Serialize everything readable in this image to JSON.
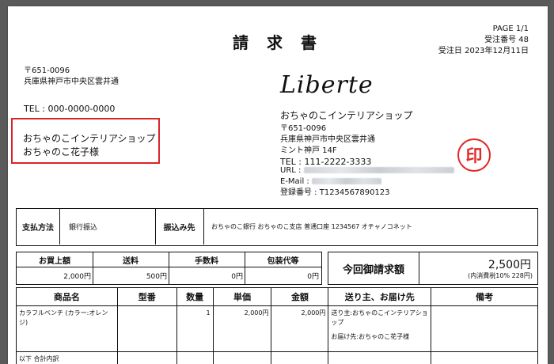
{
  "document": {
    "title": "請 求 書",
    "page": "PAGE 1/1",
    "order_no": "受注番号  48",
    "order_date": "受注日 2023年12月11日"
  },
  "recipient": {
    "postal": "〒651-0096",
    "address": "兵庫県神戸市中央区雲井通",
    "tel": "TEL : 000-0000-0000",
    "company": "おちゃのこインテリアショップ",
    "name": "おちゃのこ花子様"
  },
  "issuer": {
    "logo": "Liberte",
    "shop_name": "おちゃのこインテリアショップ",
    "postal": "〒651-0096",
    "address": "兵庫県神戸市中央区雲井通",
    "building": "ミント神戸 14F",
    "tel": "TEL : 111-2222-3333",
    "url_label": "URL :",
    "email_label": "E-Mail :",
    "registration": "登録番号 : T1234567890123",
    "stamp": "印"
  },
  "payment": {
    "method_label": "支払方法",
    "method_value": "銀行振込",
    "dest_label": "振込み先",
    "dest_value": "おちゃのこ銀行 おちゃのこ支店 普通口座 1234567 オチャノコネット"
  },
  "summary": {
    "headers": [
      "お買上額",
      "送料",
      "手数料",
      "包装代等"
    ],
    "values": [
      "2,000円",
      "500円",
      "0円",
      "0円"
    ],
    "total_label": "今回御請求額",
    "total_value": "2,500円",
    "tax_note": "(内消費税10% 228円)"
  },
  "items": {
    "headers": [
      "商品名",
      "型番",
      "数量",
      "単価",
      "金額",
      "送り主、お届け先",
      "備考"
    ],
    "rows": [
      {
        "name": "カラフルベンチ (カラー:オレンジ)",
        "model": "",
        "qty": "1",
        "unit": "2,000円",
        "amount": "2,000円",
        "sender": "送り主:おちゃのこインテリアショップ",
        "delivery": "お届け先:おちゃのこ花子様",
        "note": ""
      }
    ],
    "footer_label": "以下 合計内訳"
  }
}
